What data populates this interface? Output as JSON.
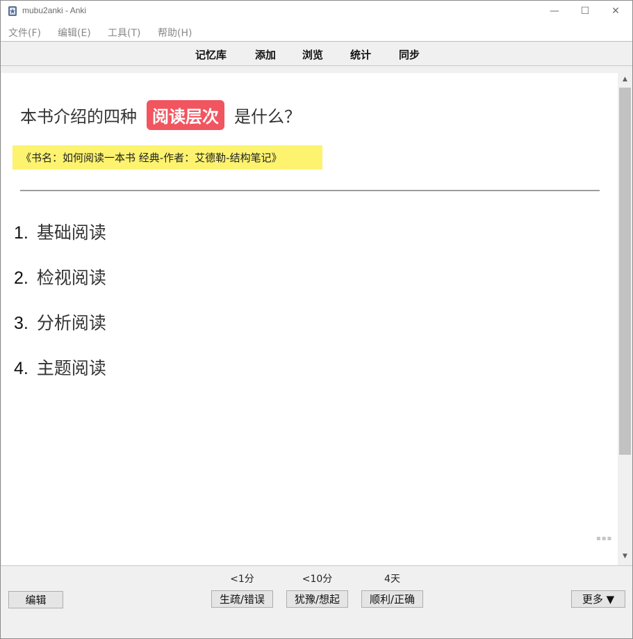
{
  "window": {
    "title": "mubu2anki - Anki",
    "controls": {
      "minimize": "—",
      "maximize": "☐",
      "close": "✕"
    }
  },
  "menu": [
    "文件(F)",
    "编辑(E)",
    "工具(T)",
    "帮助(H)"
  ],
  "toolbar": [
    "记忆库",
    "添加",
    "浏览",
    "统计",
    "同步"
  ],
  "card": {
    "question_before": "本书介绍的四种",
    "question_highlight": "阅读层次",
    "question_after": "是什么？",
    "source": "《书名：如何阅读一本书 经典-作者：艾德勒-结构笔记》",
    "answers": [
      {
        "num": "1.",
        "text": "基础阅读"
      },
      {
        "num": "2.",
        "text": "检视阅读"
      },
      {
        "num": "3.",
        "text": "分析阅读"
      },
      {
        "num": "4.",
        "text": "主题阅读"
      }
    ],
    "colors": {
      "highlight": "#f05560",
      "source_bg": "#fdf36f"
    },
    "resize_grip": "▪▪▪"
  },
  "scrollbar": {
    "up": "▲",
    "down": "▼"
  },
  "bottom": {
    "edit_label": "编辑",
    "ease_times": [
      "<1分",
      "<10分",
      "4天"
    ],
    "ease_buttons": [
      "生疏/错误",
      "犹豫/想起",
      "顺利/正确"
    ],
    "more_label": "更多 ▼"
  }
}
